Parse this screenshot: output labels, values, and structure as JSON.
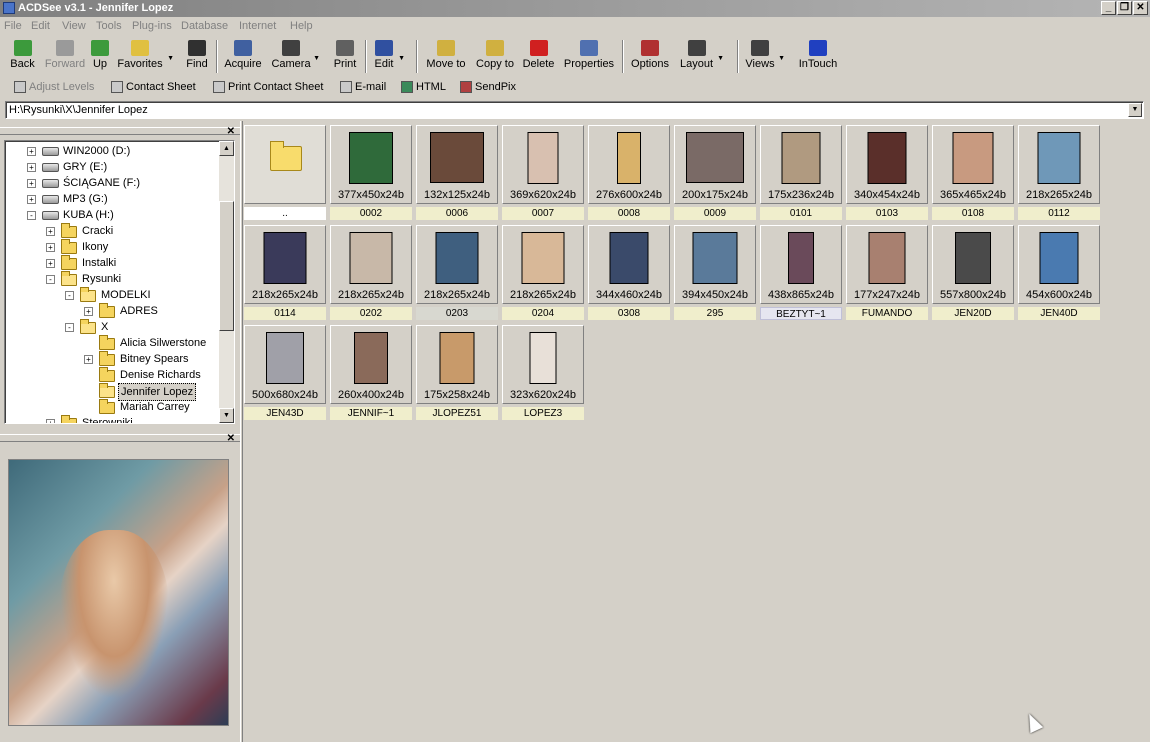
{
  "window": {
    "title": "ACDSee v3.1 - Jennifer Lopez"
  },
  "menubar": [
    "File",
    "Edit",
    "View",
    "Tools",
    "Plug-ins",
    "Database",
    "Internet",
    "Help"
  ],
  "toolbar": {
    "buttons": [
      {
        "label": "Back",
        "icon": "back-arrow-icon",
        "color": "#3c9a3c"
      },
      {
        "label": "Forward",
        "icon": "forward-arrow-icon",
        "color": "#9a9a9a"
      },
      {
        "label": "Up",
        "icon": "up-folder-icon",
        "color": "#3c9a3c"
      },
      {
        "label": "Favorites",
        "icon": "favorites-icon",
        "color": "#e0c040"
      },
      {
        "label": "Find",
        "icon": "binoculars-icon",
        "color": "#303030"
      },
      {
        "label": "Acquire",
        "icon": "acquire-icon",
        "color": "#4060a0"
      },
      {
        "label": "Camera",
        "icon": "camera-icon",
        "color": "#404040"
      },
      {
        "label": "Print",
        "icon": "printer-icon",
        "color": "#606060"
      },
      {
        "label": "Edit",
        "icon": "edit-icon",
        "color": "#3050a0"
      },
      {
        "label": "Move to",
        "icon": "move-to-icon",
        "color": "#d0b040"
      },
      {
        "label": "Copy to",
        "icon": "copy-to-icon",
        "color": "#d0b040"
      },
      {
        "label": "Delete",
        "icon": "delete-icon",
        "color": "#d02020"
      },
      {
        "label": "Properties",
        "icon": "properties-icon",
        "color": "#5070b0"
      },
      {
        "label": "Options",
        "icon": "options-icon",
        "color": "#b03030"
      },
      {
        "label": "Layout",
        "icon": "layout-icon",
        "color": "#404040"
      },
      {
        "label": "Views",
        "icon": "views-icon",
        "color": "#404040"
      },
      {
        "label": "InTouch",
        "icon": "intouch-icon",
        "color": "#2040c0"
      }
    ]
  },
  "toolbar2": [
    {
      "label": "Adjust Levels",
      "icon": "adjust-levels-icon",
      "disabled": true
    },
    {
      "label": "Contact Sheet",
      "icon": "contact-sheet-icon"
    },
    {
      "label": "Print Contact Sheet",
      "icon": "print-contact-sheet-icon"
    },
    {
      "label": "E-mail",
      "icon": "email-icon"
    },
    {
      "label": "HTML",
      "icon": "html-icon"
    },
    {
      "label": "SendPix",
      "icon": "sendpix-icon"
    }
  ],
  "address": {
    "value": "H:\\Rysunki\\X\\Jennifer Lopez"
  },
  "tree": [
    {
      "label": "WIN2000 (D:)",
      "type": "drive",
      "expand": "+"
    },
    {
      "label": "GRY (E:)",
      "type": "drive",
      "expand": "+"
    },
    {
      "label": "ŚCIĄGANE (F:)",
      "type": "drive",
      "expand": "+"
    },
    {
      "label": "MP3 (G:)",
      "type": "drive",
      "expand": "+"
    },
    {
      "label": "KUBA (H:)",
      "type": "drive",
      "expand": "-"
    },
    {
      "label": "Cracki",
      "type": "folder",
      "expand": "+"
    },
    {
      "label": "Ikony",
      "type": "folder",
      "expand": "+"
    },
    {
      "label": "Instalki",
      "type": "folder",
      "expand": "+"
    },
    {
      "label": "Rysunki",
      "type": "folder",
      "expand": "-"
    },
    {
      "label": "MODELKI",
      "type": "folder",
      "expand": "-"
    },
    {
      "label": "ADRES",
      "type": "folder",
      "expand": "+"
    },
    {
      "label": "X",
      "type": "folder",
      "expand": "-"
    },
    {
      "label": "Alicia Silwerstone",
      "type": "folder",
      "expand": ""
    },
    {
      "label": "Bitney Spears",
      "type": "folder",
      "expand": "+"
    },
    {
      "label": "Denise Richards",
      "type": "folder",
      "expand": ""
    },
    {
      "label": "Jennifer Lopez",
      "type": "folder",
      "expand": "",
      "selected": true
    },
    {
      "label": "Mariah Carrey",
      "type": "folder",
      "expand": ""
    },
    {
      "label": "Sterowniki",
      "type": "folder",
      "expand": "+"
    }
  ],
  "files": [
    {
      "name": "..",
      "dims": "",
      "folder": true
    },
    {
      "name": "0002",
      "dims": "377x450x24b",
      "tone": "#2f6a3a"
    },
    {
      "name": "0006",
      "dims": "132x125x24b",
      "tone": "#6a4a3a"
    },
    {
      "name": "0007",
      "dims": "369x620x24b",
      "tone": "#d8c0b0"
    },
    {
      "name": "0008",
      "dims": "276x600x24b",
      "tone": "#d9b26a"
    },
    {
      "name": "0009",
      "dims": "200x175x24b",
      "tone": "#7a6a66"
    },
    {
      "name": "0101",
      "dims": "175x236x24b",
      "tone": "#b09a80"
    },
    {
      "name": "0103",
      "dims": "340x454x24b",
      "tone": "#5a2f2a"
    },
    {
      "name": "0108",
      "dims": "365x465x24b",
      "tone": "#c89a80"
    },
    {
      "name": "0112",
      "dims": "218x265x24b",
      "tone": "#6f98b8"
    },
    {
      "name": "0114",
      "dims": "218x265x24b",
      "tone": "#3a3a5a"
    },
    {
      "name": "0202",
      "dims": "218x265x24b",
      "tone": "#c8b8a8"
    },
    {
      "name": "0203",
      "dims": "218x265x24b",
      "tone": "#3f5f7f"
    },
    {
      "name": "0204",
      "dims": "218x265x24b",
      "tone": "#d8b898"
    },
    {
      "name": "0308",
      "dims": "344x460x24b",
      "tone": "#3a4a6a"
    },
    {
      "name": "295",
      "dims": "394x450x24b",
      "tone": "#5a7a9a"
    },
    {
      "name": "BEZTYT~1",
      "dims": "438x865x24b",
      "tone": "#6a4a5a"
    },
    {
      "name": "FUMANDO",
      "dims": "177x247x24b",
      "tone": "#a88070"
    },
    {
      "name": "JEN20D",
      "dims": "557x800x24b",
      "tone": "#4a4a4a"
    },
    {
      "name": "JEN40D",
      "dims": "454x600x24b",
      "tone": "#4a7ab0"
    },
    {
      "name": "JEN43D",
      "dims": "500x680x24b",
      "tone": "#a0a0a8"
    },
    {
      "name": "JENNIF~1",
      "dims": "260x400x24b",
      "tone": "#8a6a5a"
    },
    {
      "name": "JLOPEZ51",
      "dims": "175x258x24b",
      "tone": "#c89a6a"
    },
    {
      "name": "LOPEZ3",
      "dims": "323x620x24b",
      "tone": "#e8e0d8"
    }
  ]
}
